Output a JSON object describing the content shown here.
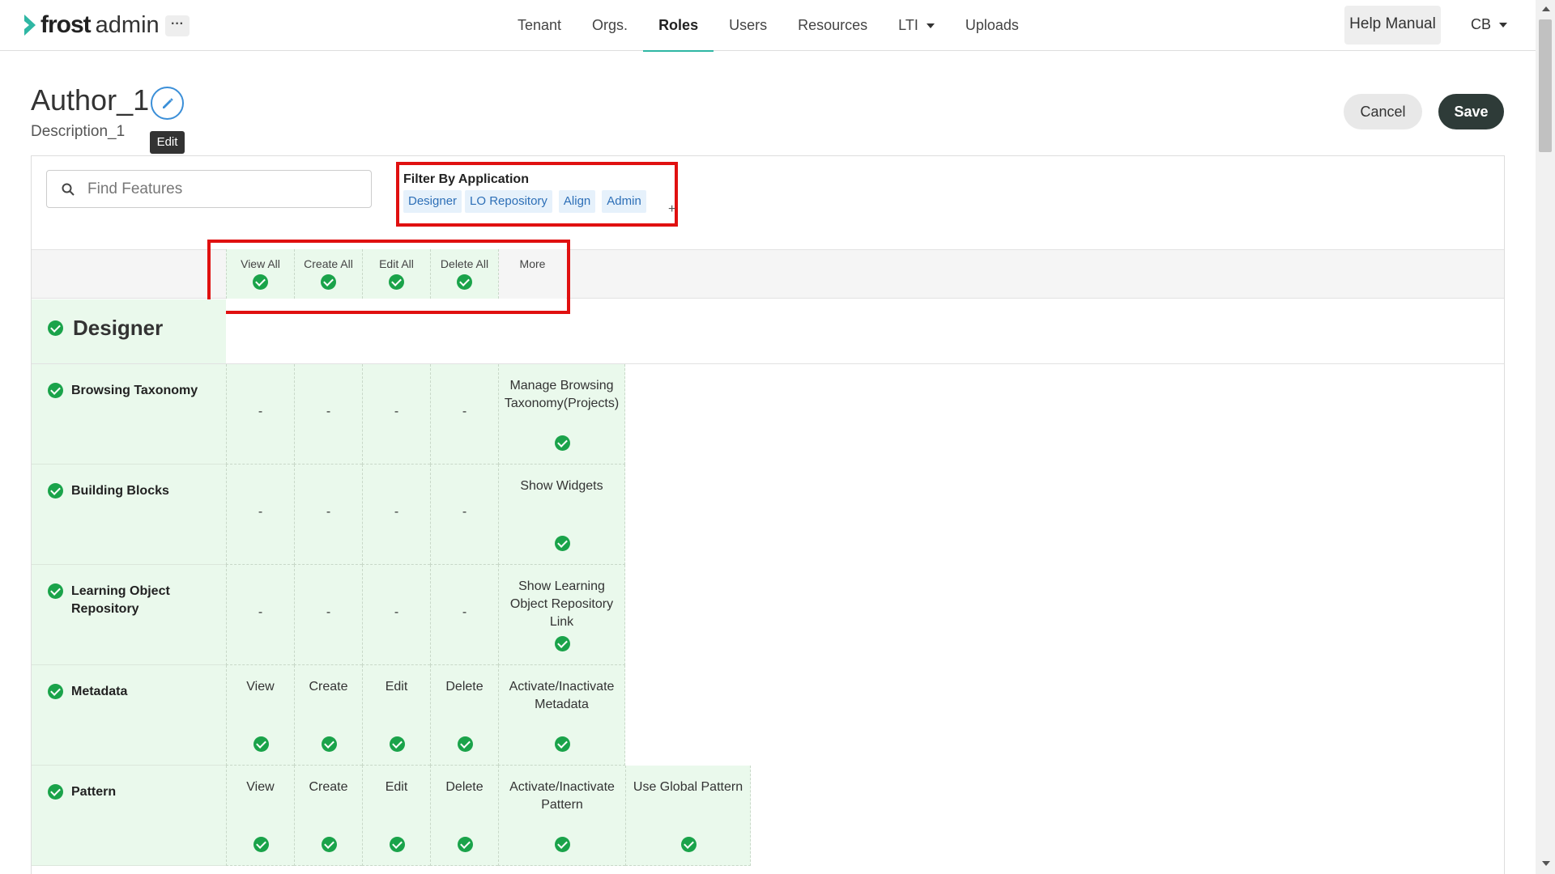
{
  "app": {
    "brand_main": "frost",
    "brand_sub": "admin",
    "more_label": "···"
  },
  "nav": {
    "items": [
      {
        "label": "Tenant"
      },
      {
        "label": "Orgs."
      },
      {
        "label": "Roles",
        "active": true
      },
      {
        "label": "Users"
      },
      {
        "label": "Resources"
      },
      {
        "label": "LTI"
      },
      {
        "label": "Uploads"
      }
    ],
    "help_label": "Help Manual",
    "user_label": "CB"
  },
  "role": {
    "title": "Author_1",
    "description": "Description_1",
    "edit_tooltip": "Edit",
    "cancel_label": "Cancel",
    "save_label": "Save"
  },
  "search": {
    "placeholder": "Find Features",
    "value": ""
  },
  "filter": {
    "title": "Filter By Application",
    "chips": [
      "Designer",
      "LO Repository",
      "Align",
      "Admin"
    ]
  },
  "bulk_header": {
    "columns": [
      "View All",
      "Create All",
      "Edit All",
      "Delete All",
      "More"
    ]
  },
  "section": {
    "title": "Designer"
  },
  "features": [
    {
      "name": "Browsing Taxonomy",
      "crud": [
        "-",
        "-",
        "-",
        "-"
      ],
      "more": [
        "Manage Browsing Taxonomy(Projects)"
      ]
    },
    {
      "name": "Building Blocks",
      "crud": [
        "-",
        "-",
        "-",
        "-"
      ],
      "more": [
        "Show Widgets"
      ]
    },
    {
      "name": "Learning Object Repository",
      "crud": [
        "-",
        "-",
        "-",
        "-"
      ],
      "more": [
        "Show Learning Object Repository Link"
      ]
    },
    {
      "name": "Metadata",
      "crud": [
        "View",
        "Create",
        "Edit",
        "Delete"
      ],
      "more": [
        "Activate/Inactivate Metadata"
      ]
    },
    {
      "name": "Pattern",
      "crud": [
        "View",
        "Create",
        "Edit",
        "Delete"
      ],
      "more": [
        "Activate/Inactivate Pattern",
        "Use Global Pattern"
      ]
    }
  ],
  "colors": {
    "accent": "#2fb7a4",
    "check": "#1aa34a",
    "highlight": "#e01010",
    "row_bg": "#eaf9ec",
    "chip_bg": "#e6f1fb",
    "save_bg": "#2e3b38"
  }
}
